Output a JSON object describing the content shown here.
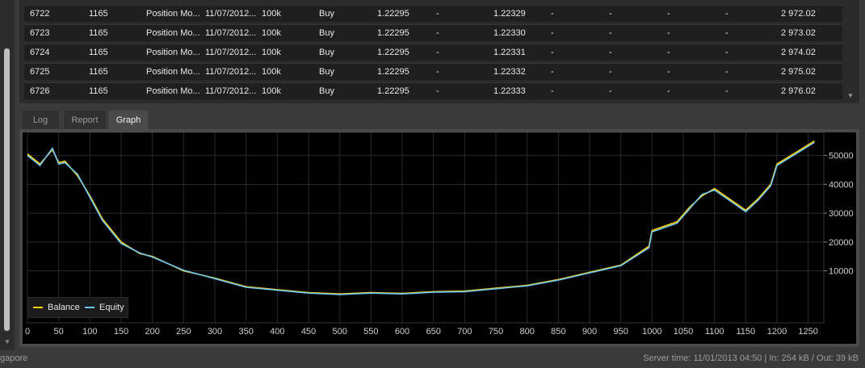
{
  "table": {
    "rows": [
      {
        "id": "6722",
        "order": "1165",
        "type": "Position Mo...",
        "time": "11/07/2012...",
        "amount": "100k",
        "side": "Buy",
        "open": "1.22295",
        "c1": "-",
        "close": "1.22329",
        "c2": "-",
        "c3": "-",
        "c4": "-",
        "c5": "-",
        "profit": "2 972.02"
      },
      {
        "id": "6723",
        "order": "1165",
        "type": "Position Mo...",
        "time": "11/07/2012...",
        "amount": "100k",
        "side": "Buy",
        "open": "1.22295",
        "c1": "-",
        "close": "1.22330",
        "c2": "-",
        "c3": "-",
        "c4": "-",
        "c5": "-",
        "profit": "2 973.02"
      },
      {
        "id": "6724",
        "order": "1165",
        "type": "Position Mo...",
        "time": "11/07/2012...",
        "amount": "100k",
        "side": "Buy",
        "open": "1.22295",
        "c1": "-",
        "close": "1.22331",
        "c2": "-",
        "c3": "-",
        "c4": "-",
        "c5": "-",
        "profit": "2 974.02"
      },
      {
        "id": "6725",
        "order": "1165",
        "type": "Position Mo...",
        "time": "11/07/2012...",
        "amount": "100k",
        "side": "Buy",
        "open": "1.22295",
        "c1": "-",
        "close": "1.22332",
        "c2": "-",
        "c3": "-",
        "c4": "-",
        "c5": "-",
        "profit": "2 975.02"
      },
      {
        "id": "6726",
        "order": "1165",
        "type": "Position Mo...",
        "time": "11/07/2012...",
        "amount": "100k",
        "side": "Buy",
        "open": "1.22295",
        "c1": "-",
        "close": "1.22333",
        "c2": "-",
        "c3": "-",
        "c4": "-",
        "c5": "-",
        "profit": "2 976.02"
      }
    ]
  },
  "tabs": [
    {
      "label": "Log",
      "active": false
    },
    {
      "label": "Report",
      "active": false
    },
    {
      "label": "Graph",
      "active": true
    }
  ],
  "chart_data": {
    "type": "line",
    "xlim": [
      0,
      1275
    ],
    "ylim": [
      -8000,
      58000
    ],
    "x_ticks": [
      0,
      50,
      100,
      150,
      200,
      250,
      300,
      350,
      400,
      450,
      500,
      550,
      600,
      650,
      700,
      750,
      800,
      850,
      900,
      950,
      1000,
      1050,
      1100,
      1150,
      1200,
      1250
    ],
    "y_ticks": [
      10000,
      20000,
      30000,
      40000,
      50000
    ],
    "y_tick_labels": [
      "10000",
      "20000",
      "30000",
      "40000",
      "50000"
    ],
    "grid": true,
    "legend_position": "bottom-left",
    "series": [
      {
        "name": "Balance",
        "color": "#ffd400",
        "x": [
          0,
          20,
          40,
          50,
          60,
          80,
          100,
          120,
          150,
          180,
          200,
          250,
          300,
          350,
          400,
          450,
          500,
          550,
          600,
          650,
          700,
          750,
          800,
          850,
          900,
          950,
          995,
          1000,
          1040,
          1060,
          1080,
          1100,
          1130,
          1150,
          1170,
          1190,
          1200,
          1230,
          1260
        ],
        "y": [
          50500,
          47000,
          52000,
          47500,
          48000,
          43000,
          36000,
          28000,
          20000,
          16000,
          15000,
          10000,
          7500,
          4500,
          3500,
          2500,
          2000,
          2500,
          2200,
          2800,
          3000,
          4000,
          5000,
          7000,
          9500,
          12000,
          18500,
          24000,
          27000,
          32000,
          36000,
          38500,
          34000,
          31000,
          35000,
          40000,
          47000,
          51000,
          55000
        ]
      },
      {
        "name": "Equity",
        "color": "#6ec6f0",
        "x": [
          0,
          20,
          40,
          50,
          60,
          80,
          100,
          120,
          150,
          180,
          200,
          250,
          300,
          350,
          400,
          450,
          500,
          550,
          600,
          650,
          700,
          750,
          800,
          850,
          900,
          950,
          995,
          1000,
          1040,
          1060,
          1080,
          1100,
          1130,
          1150,
          1170,
          1190,
          1200,
          1230,
          1260
        ],
        "y": [
          50000,
          46500,
          52500,
          47000,
          47500,
          43500,
          35500,
          27500,
          19500,
          16200,
          14800,
          10200,
          7300,
          4300,
          3300,
          2300,
          1800,
          2300,
          2000,
          2600,
          2800,
          3800,
          4800,
          6800,
          9300,
          11800,
          18000,
          23500,
          26500,
          31500,
          36500,
          38000,
          33500,
          30500,
          34500,
          39500,
          46500,
          50500,
          54500
        ]
      }
    ]
  },
  "legend": [
    {
      "label": "Balance",
      "color": "#ffd400"
    },
    {
      "label": "Equity",
      "color": "#6ec6f0"
    }
  ],
  "status": {
    "left": "gapore",
    "right": "Server time: 11/01/2013 04:50  |  In: 254 kB / Out: 39 kB"
  }
}
